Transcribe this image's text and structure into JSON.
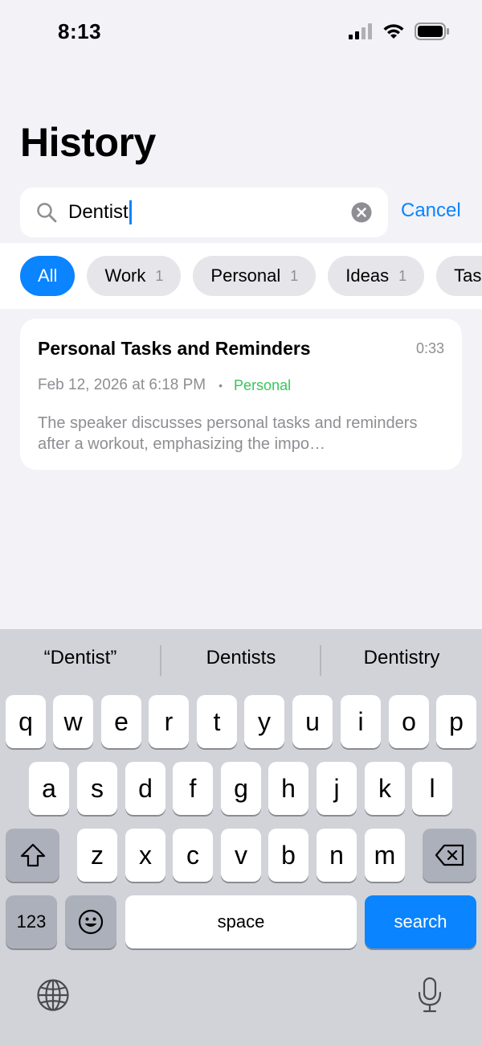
{
  "status": {
    "time": "8:13"
  },
  "title": "History",
  "search": {
    "value": "Dentist",
    "cancel_label": "Cancel"
  },
  "filters": [
    {
      "label": "All",
      "count": ""
    },
    {
      "label": "Work",
      "count": "1"
    },
    {
      "label": "Personal",
      "count": "1"
    },
    {
      "label": "Ideas",
      "count": "1"
    },
    {
      "label": "Task",
      "count": ""
    }
  ],
  "results": [
    {
      "title": "Personal Tasks and Reminders",
      "duration": "0:33",
      "date": "Feb 12, 2026 at 6:18 PM",
      "category": "Personal",
      "summary": "The speaker discusses personal tasks and reminders after a workout, emphasizing the impo…"
    }
  ],
  "keyboard": {
    "suggestions": [
      "“Dentist”",
      "Dentists",
      "Dentistry"
    ],
    "row1": [
      "q",
      "w",
      "e",
      "r",
      "t",
      "y",
      "u",
      "i",
      "o",
      "p"
    ],
    "row2": [
      "a",
      "s",
      "d",
      "f",
      "g",
      "h",
      "j",
      "k",
      "l"
    ],
    "row3": [
      "z",
      "x",
      "c",
      "v",
      "b",
      "n",
      "m"
    ],
    "numbers_label": "123",
    "space_label": "space",
    "search_label": "search"
  },
  "colors": {
    "accent": "#0a84ff",
    "tag_green": "#34c759",
    "background": "#f2f2f7",
    "keyboard_bg": "#d1d3d9"
  }
}
